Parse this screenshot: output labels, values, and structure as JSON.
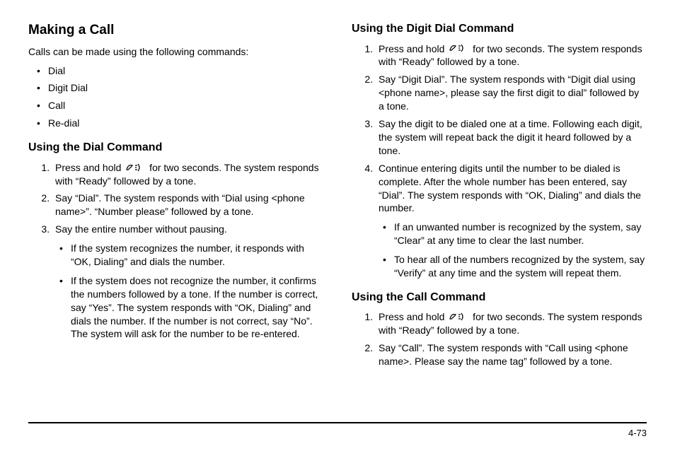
{
  "left": {
    "h1": "Making a Call",
    "intro": "Calls can be made using the following commands:",
    "commands": [
      "Dial",
      "Digit Dial",
      "Call",
      "Re-dial"
    ],
    "dial": {
      "heading": "Using the Dial Command",
      "step1_a": "Press and hold ",
      "step1_b": " for two seconds. The system responds with “Ready” followed by a tone.",
      "step2": "Say “Dial”. The system responds with “Dial using <phone name>”. “Number please” followed by a tone.",
      "step3": "Say the entire number without pausing.",
      "sub1": "If the system recognizes the number, it responds with “OK, Dialing” and dials the number.",
      "sub2": "If the system does not recognize the number, it confirms the numbers followed by a tone. If the number is correct, say “Yes”. The system responds with “OK, Dialing” and dials the number. If the number is not correct, say “No”. The system will ask for the number to be re-entered."
    }
  },
  "right": {
    "digit": {
      "heading": "Using the Digit Dial Command",
      "step1_a": "Press and hold ",
      "step1_b": " for two seconds. The system responds with “Ready” followed by a tone.",
      "step2": "Say “Digit Dial”. The system responds with “Digit dial using <phone name>, please say the first digit to dial” followed by a tone.",
      "step3": "Say the digit to be dialed one at a time. Following each digit, the system will repeat back the digit it heard followed by a tone.",
      "step4": "Continue entering digits until the number to be dialed is complete. After the whole number has been entered, say “Dial”. The system responds with “OK, Dialing” and dials the number.",
      "sub1": "If an unwanted number is recognized by the system, say “Clear” at any time to clear the last number.",
      "sub2": "To hear all of the numbers recognized by the system, say “Verify” at any time and the system will repeat them."
    },
    "call": {
      "heading": "Using the Call Command",
      "step1_a": "Press and hold ",
      "step1_b": " for two seconds. The system responds with “Ready” followed by a tone.",
      "step2": "Say “Call”. The system responds with “Call using <phone name>. Please say the name tag” followed by a tone."
    }
  },
  "page_number": "4-73"
}
